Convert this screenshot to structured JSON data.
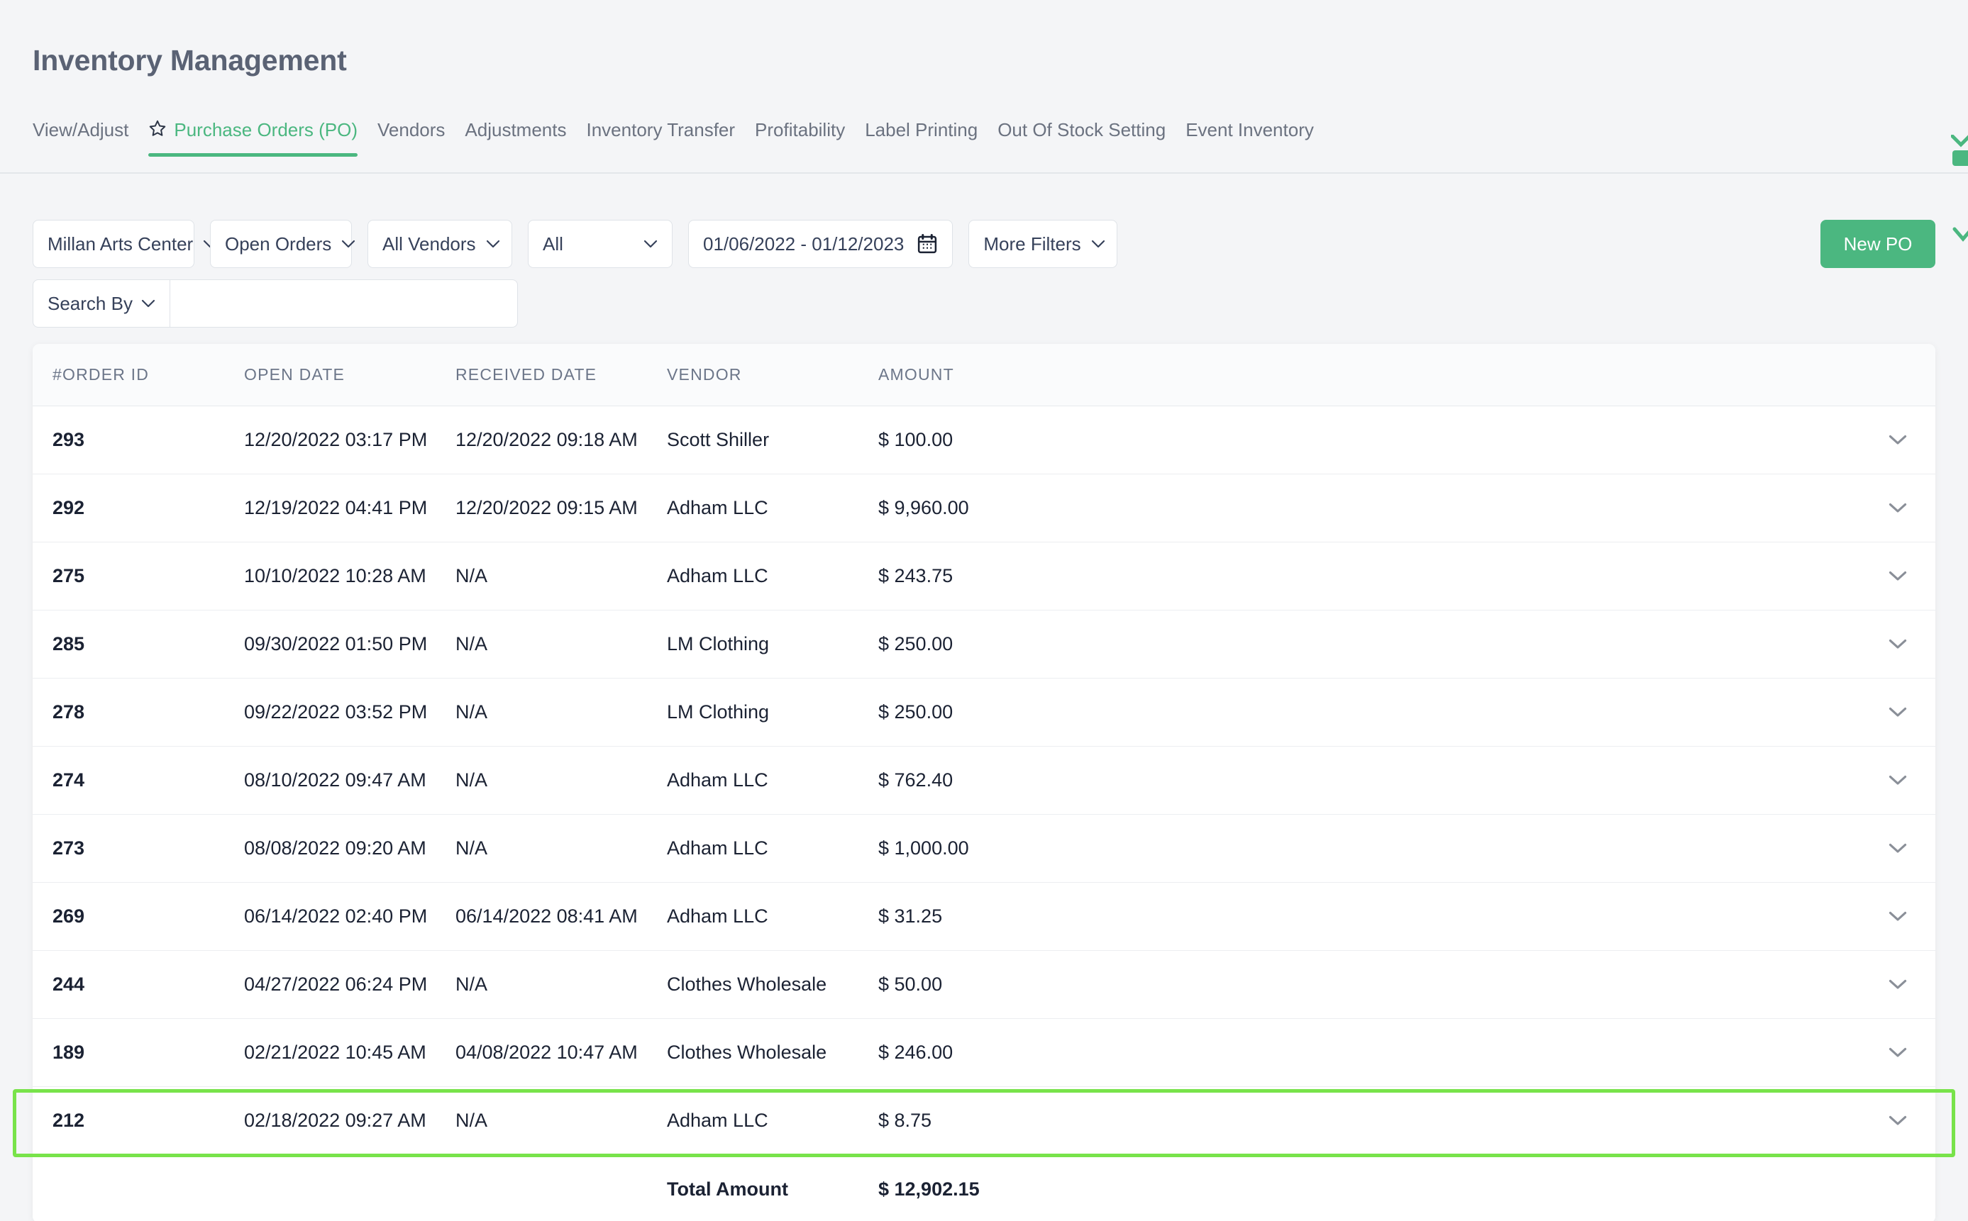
{
  "header": {
    "title": "Inventory Management",
    "tabs": [
      {
        "label": "View/Adjust",
        "active": false,
        "starred": false
      },
      {
        "label": "Purchase Orders (PO)",
        "active": true,
        "starred": true
      },
      {
        "label": "Vendors",
        "active": false,
        "starred": false
      },
      {
        "label": "Adjustments",
        "active": false,
        "starred": false
      },
      {
        "label": "Inventory Transfer",
        "active": false,
        "starred": false
      },
      {
        "label": "Profitability",
        "active": false,
        "starred": false
      },
      {
        "label": "Label Printing",
        "active": false,
        "starred": false
      },
      {
        "label": "Out Of Stock Setting",
        "active": false,
        "starred": false
      },
      {
        "label": "Event Inventory",
        "active": false,
        "starred": false
      }
    ]
  },
  "filters": {
    "location": "Millan Arts Center",
    "status": "Open Orders",
    "vendor": "All Vendors",
    "type": "All",
    "date_range": "01/06/2022 - 01/12/2023",
    "more_filters": "More Filters",
    "search_by": "Search By",
    "search_value": "",
    "search_placeholder": "",
    "new_po": "New PO"
  },
  "table": {
    "columns": [
      "#ORDER ID",
      "OPEN DATE",
      "RECEIVED DATE",
      "VENDOR",
      "AMOUNT"
    ],
    "rows": [
      {
        "order_id": "293",
        "open_date": "12/20/2022 03:17 PM",
        "received_date": "12/20/2022 09:18 AM",
        "vendor": "Scott Shiller",
        "amount": "$ 100.00",
        "highlighted": false
      },
      {
        "order_id": "292",
        "open_date": "12/19/2022 04:41 PM",
        "received_date": "12/20/2022 09:15 AM",
        "vendor": "Adham LLC",
        "amount": "$ 9,960.00",
        "highlighted": false
      },
      {
        "order_id": "275",
        "open_date": "10/10/2022 10:28 AM",
        "received_date": "N/A",
        "vendor": "Adham LLC",
        "amount": "$ 243.75",
        "highlighted": false
      },
      {
        "order_id": "285",
        "open_date": "09/30/2022 01:50 PM",
        "received_date": "N/A",
        "vendor": "LM Clothing",
        "amount": "$ 250.00",
        "highlighted": false
      },
      {
        "order_id": "278",
        "open_date": "09/22/2022 03:52 PM",
        "received_date": "N/A",
        "vendor": "LM Clothing",
        "amount": "$ 250.00",
        "highlighted": false
      },
      {
        "order_id": "274",
        "open_date": "08/10/2022 09:47 AM",
        "received_date": "N/A",
        "vendor": "Adham LLC",
        "amount": "$ 762.40",
        "highlighted": false
      },
      {
        "order_id": "273",
        "open_date": "08/08/2022 09:20 AM",
        "received_date": "N/A",
        "vendor": "Adham LLC",
        "amount": "$ 1,000.00",
        "highlighted": false
      },
      {
        "order_id": "269",
        "open_date": "06/14/2022 02:40 PM",
        "received_date": "06/14/2022 08:41 AM",
        "vendor": "Adham LLC",
        "amount": "$ 31.25",
        "highlighted": false
      },
      {
        "order_id": "244",
        "open_date": "04/27/2022 06:24 PM",
        "received_date": "N/A",
        "vendor": "Clothes Wholesale",
        "amount": "$ 50.00",
        "highlighted": false
      },
      {
        "order_id": "189",
        "open_date": "02/21/2022 10:45 AM",
        "received_date": "04/08/2022 10:47 AM",
        "vendor": "Clothes Wholesale",
        "amount": "$ 246.00",
        "highlighted": false
      },
      {
        "order_id": "212",
        "open_date": "02/18/2022 09:27 AM",
        "received_date": "N/A",
        "vendor": "Adham LLC",
        "amount": "$ 8.75",
        "highlighted": true
      }
    ],
    "total_label": "Total Amount",
    "total_amount": "$ 12,902.15"
  },
  "colors": {
    "accent_green": "#4bb780",
    "highlight_green": "#78e34a",
    "page_bg": "#f4f5f7",
    "text_dark": "#1b2233",
    "text_muted": "#6b7280"
  }
}
